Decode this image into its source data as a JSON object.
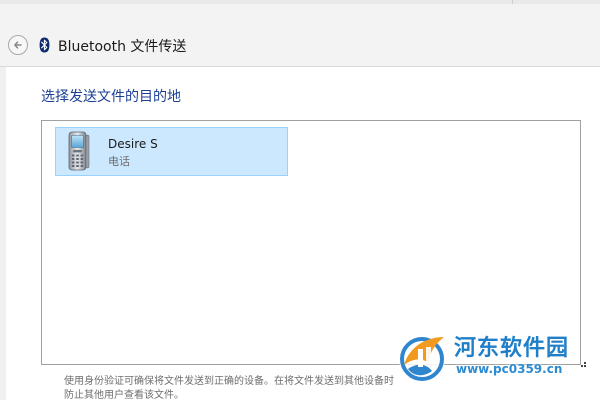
{
  "window": {
    "title": "Bluetooth 文件传送"
  },
  "header": {
    "back_icon": "back-arrow-icon",
    "bluetooth_icon": "bluetooth-icon"
  },
  "main": {
    "heading": "选择发送文件的目的地",
    "devices": [
      {
        "name": "Desire S",
        "type": "电话",
        "icon": "mobile-phone-icon",
        "selected": true
      }
    ],
    "info_line_1": "使用身份验证可确保将文件发送到正确的设备。在将文件发送到其他设备时",
    "info_line_2": "防止其他用户查看该文件。"
  },
  "watermark": {
    "name": "河东软件园",
    "url": "www.pc0359.cn"
  },
  "colors": {
    "heading": "#1c3f94",
    "selection_fill": "#cce8ff",
    "selection_border": "#99d1ff",
    "watermark_blue": "#1f7fc8"
  }
}
